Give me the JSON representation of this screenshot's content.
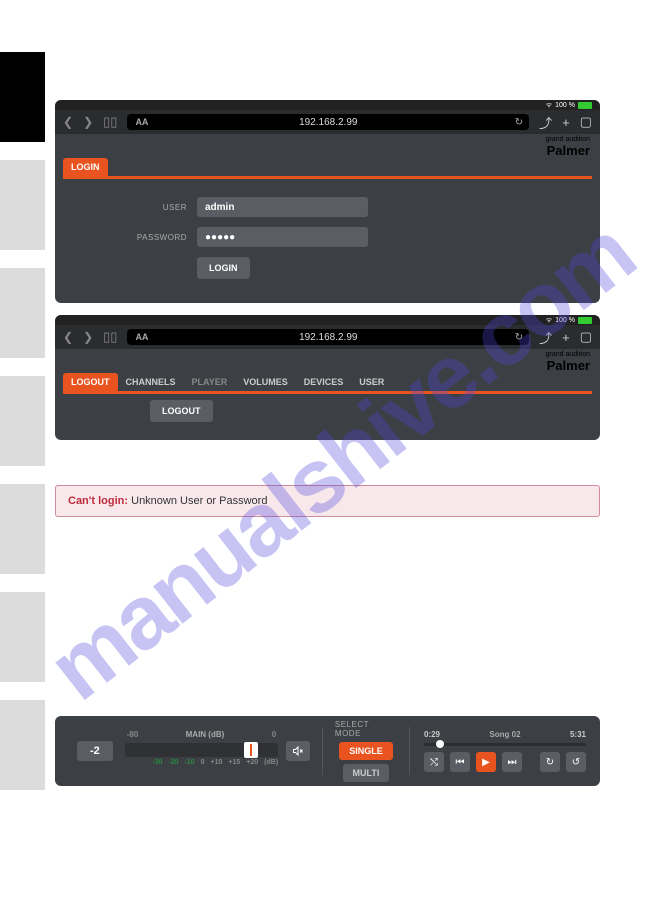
{
  "status": {
    "battery": "100 %"
  },
  "browser": {
    "url": "192.168.2.99",
    "aa": "AA"
  },
  "brand": {
    "tagline": "grand audition",
    "name": "Palmer"
  },
  "login": {
    "tab": "LOGIN",
    "user_label": "USER",
    "user_value": "admin",
    "pass_label": "PASSWORD",
    "pass_value": "●●●●●",
    "button": "LOGIN"
  },
  "logout": {
    "tabs": [
      "LOGOUT",
      "CHANNELS",
      "PLAYER",
      "VOLUMES",
      "DEVICES",
      "USER"
    ],
    "button": "LOGOUT"
  },
  "error": {
    "title": "Can't login:",
    "msg": " Unknown User or Password"
  },
  "player": {
    "value": "-2",
    "scale_neg": "-80",
    "scale_title": "MAIN (dB)",
    "scale_zero": "0",
    "ticks": [
      "-30",
      "-20",
      "-10",
      "0",
      "+10",
      "+15",
      "+20"
    ],
    "tick_unit": "(dB)",
    "mode_title": "SELECT MODE",
    "single": "SINGLE",
    "multi": "MULTI",
    "time_cur": "0:29",
    "song": "Song 02",
    "time_tot": "5:31"
  },
  "watermark": "manualshive.com"
}
